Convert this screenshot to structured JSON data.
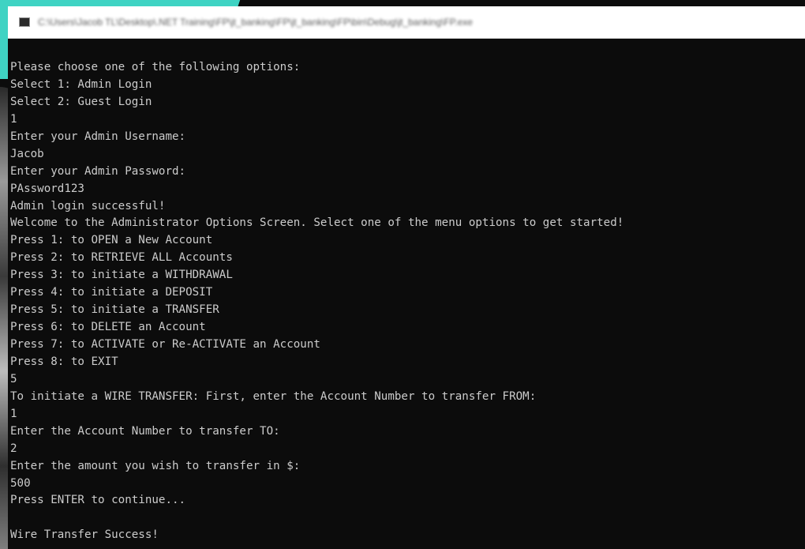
{
  "window": {
    "title": "C:\\Users\\Jacob TL\\Desktop\\.NET Training\\FP\\jt_banking\\FP\\jt_banking\\FP\\bin\\Debug\\jt_banking\\FP.exe"
  },
  "console": {
    "lines": [
      "Please choose one of the following options:",
      "Select 1: Admin Login",
      "Select 2: Guest Login",
      "1",
      "Enter your Admin Username:",
      "Jacob",
      "Enter your Admin Password:",
      "PAssword123",
      "Admin login successful!",
      "Welcome to the Administrator Options Screen. Select one of the menu options to get started!",
      "Press 1: to OPEN a New Account",
      "Press 2: to RETRIEVE ALL Accounts",
      "Press 3: to initiate a WITHDRAWAL",
      "Press 4: to initiate a DEPOSIT",
      "Press 5: to initiate a TRANSFER",
      "Press 6: to DELETE an Account",
      "Press 7: to ACTIVATE or Re-ACTIVATE an Account",
      "Press 8: to EXIT",
      "5",
      "To initiate a WIRE TRANSFER: First, enter the Account Number to transfer FROM:",
      "1",
      "Enter the Account Number to transfer TO:",
      "2",
      "Enter the amount you wish to transfer in $:",
      "500",
      "Press ENTER to continue...",
      "",
      "Wire Transfer Success!"
    ]
  },
  "colors": {
    "console_background": "#0c0c0c",
    "console_text": "#cccccc",
    "titlebar_background": "#ffffff",
    "background_accent": "#3fd3c3"
  }
}
